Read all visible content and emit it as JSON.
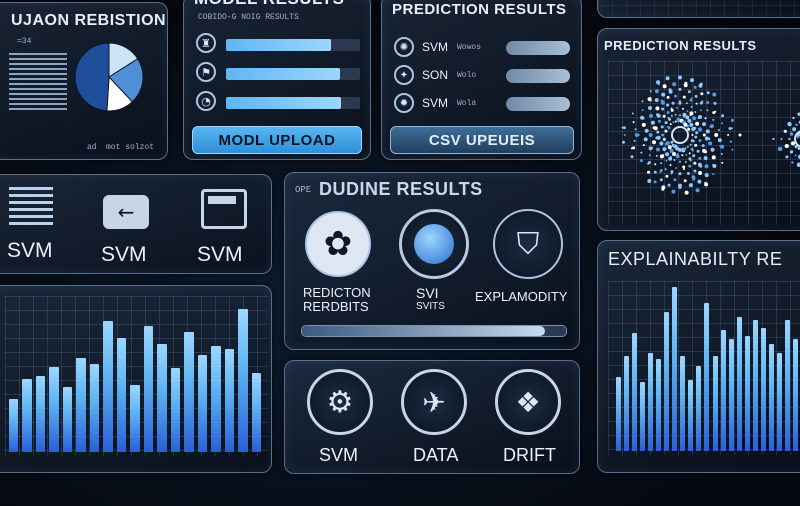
{
  "panels": {
    "tl_title": "UJAON REBISTION",
    "tl_small": [
      "=34",
      "ad",
      "mot solzot"
    ],
    "model_title": "MODEL RESULTS",
    "model_subtitle": "COBIDO-G NOIG RESULTS",
    "model_bars": [
      0.78,
      0.85,
      0.86
    ],
    "model_button": "MODL UPLOAD",
    "pred_title": "PREDICTION RESULTS",
    "pred_rows": [
      {
        "label": "SVM",
        "tag": "Wowos",
        "level": 0.55
      },
      {
        "label": "SON",
        "tag": "Wolo",
        "level": 0.65
      },
      {
        "label": "SVM",
        "tag": "Wola",
        "level": 0.6
      }
    ],
    "pred_button": "CSV UPEUEIS",
    "pred_results_title": "PREDICTION RESULTS",
    "svm_labels": [
      "SVM",
      "SVM",
      "SVM"
    ],
    "dd_title": "DUDINE RESULTS",
    "dd_prefix": "OPE",
    "dd_captions": [
      [
        "REDICTON",
        "RERDBITS"
      ],
      [
        "SVI",
        "SVITS"
      ],
      [
        "EXPLAMODITY",
        ""
      ]
    ],
    "slider_level": 0.92,
    "bottom_labels": [
      "SVM",
      "DATA",
      "DRIFT"
    ],
    "explain_title": "EXPLAINABILTY RE"
  },
  "charts": {
    "left_bars": [
      0.35,
      0.48,
      0.5,
      0.56,
      0.43,
      0.62,
      0.58,
      0.86,
      0.75,
      0.44,
      0.83,
      0.71,
      0.55,
      0.79,
      0.64,
      0.7,
      0.68,
      0.94,
      0.52
    ],
    "right_bars": [
      0.45,
      0.58,
      0.72,
      0.42,
      0.6,
      0.56,
      0.85,
      1.0,
      0.58,
      0.43,
      0.52,
      0.9,
      0.58,
      0.74,
      0.68,
      0.82,
      0.7,
      0.8,
      0.75,
      0.65,
      0.6,
      0.8,
      0.68,
      0.5
    ],
    "pie": [
      0.16,
      0.22,
      0.13,
      0.49
    ]
  },
  "colors": {
    "accent": "#5fb6f3",
    "bright": "#9dd6ff",
    "deep": "#2a5fd8"
  }
}
